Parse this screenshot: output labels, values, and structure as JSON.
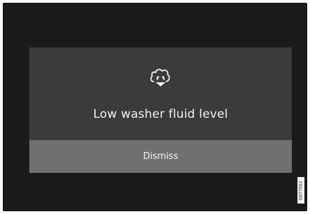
{
  "notification": {
    "icon": "washer-fluid-icon",
    "message": "Low washer fluid level",
    "dismiss_label": "Dismiss"
  },
  "reference_code": "G077002",
  "colors": {
    "screen_background": "#1b1b1b",
    "dialog_background": "#3b3b3b",
    "button_background": "#707070",
    "text": "#f2f2f2"
  }
}
